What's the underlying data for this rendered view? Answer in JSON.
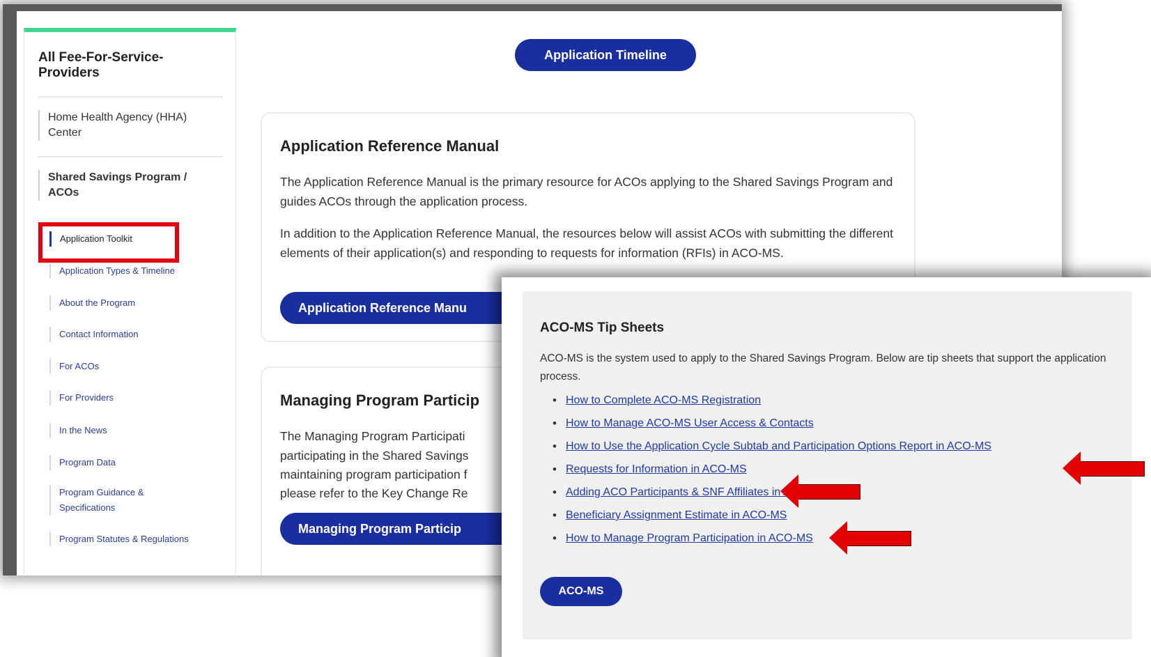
{
  "sidebar": {
    "title": "All Fee-For-Service-Providers",
    "groups": [
      {
        "label": "Home Health Agency (HHA) Center"
      },
      {
        "label": "Shared Savings Program / ACOs"
      }
    ],
    "items": [
      {
        "label": "Application Toolkit",
        "active": true
      },
      {
        "label": "Application Types & Timeline"
      },
      {
        "label": "About the Program"
      },
      {
        "label": "Contact Information"
      },
      {
        "label": "For ACOs"
      },
      {
        "label": "For Providers"
      },
      {
        "label": "In the News"
      },
      {
        "label": "Program Data"
      },
      {
        "label": "Program Guidance & Specifications"
      },
      {
        "label": "Program Statutes & Regulations"
      }
    ]
  },
  "main": {
    "timeline_button": "Application Timeline",
    "manual_card": {
      "title": "Application Reference Manual",
      "paragraph1": "The Application Reference Manual is the primary resource for ACOs applying to the Shared Savings Program and guides ACOs through the application process.",
      "paragraph2": "In addition to the Application Reference Manual, the resources below will assist ACOs with submitting the different elements of their application(s) and responding to requests for information (RFIs) in ACO-MS.",
      "button": "Application Reference Manu"
    },
    "participation_card": {
      "title": "Managing Program Particip",
      "lines": [
        "The Managing Program Participati",
        "participating in the Shared Savings",
        "maintaining program participation f",
        "please refer to the Key Change Re"
      ],
      "button": "Managing Program Particip"
    }
  },
  "tip_sheets": {
    "title": "ACO-MS Tip Sheets",
    "intro": "ACO-MS is the system used to apply to the Shared Savings Program. Below are tip sheets that support the application process.",
    "links": [
      "How to Complete ACO-MS Registration",
      "How to Manage ACO-MS User Access & Contacts",
      "How to Use the Application Cycle Subtab and Participation Options Report in ACO-MS",
      "Requests for Information in ACO-MS",
      "Adding ACO Participants & SNF Affiliates in ACO-MS",
      "Beneficiary Assignment Estimate in ACO-MS",
      "How to Manage Program Participation in ACO-MS"
    ],
    "button": "ACO-MS"
  },
  "annotations": {
    "highlight_color": "#e3000f",
    "arrow_color": "#e30000",
    "highlighted_item": "Application Toolkit",
    "arrowed_links": [
      "How to Use the Application Cycle Subtab and Participation Options Report in ACO-MS",
      "Requests for Information in ACO-MS",
      "Beneficiary Assignment Estimate in ACO-MS"
    ]
  }
}
